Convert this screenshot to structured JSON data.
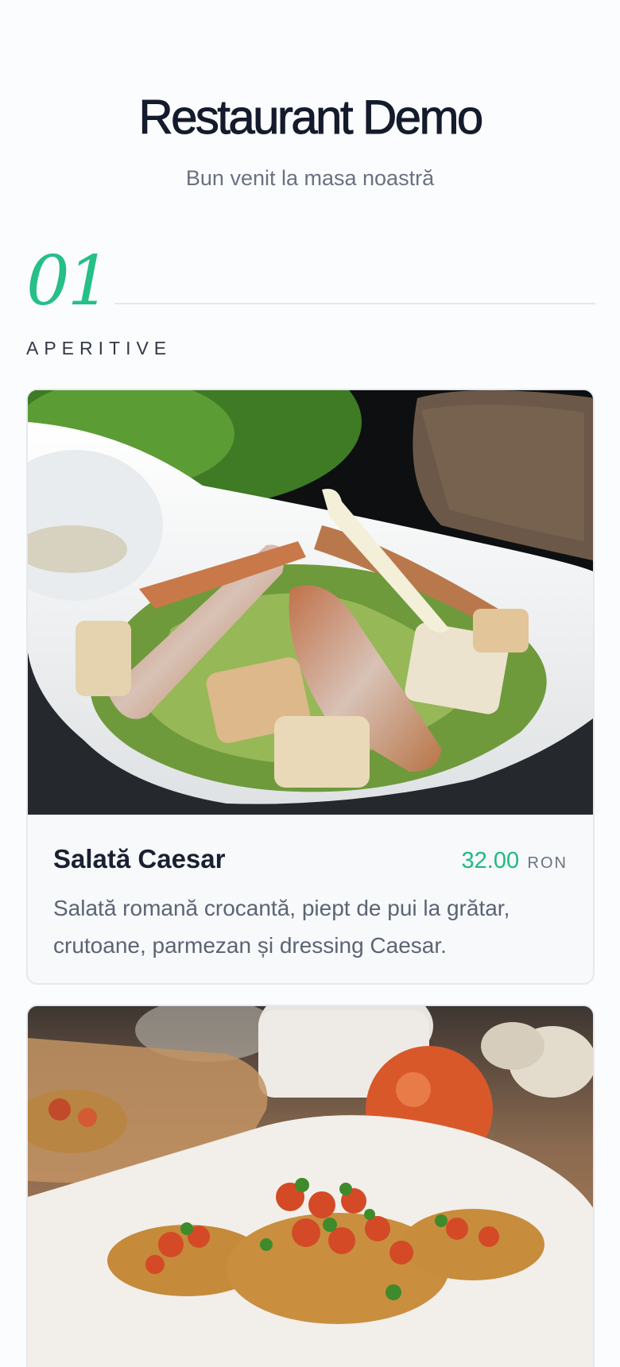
{
  "restaurant": {
    "title": "Restaurant Demo",
    "subtitle": "Bun venit la masa noastră"
  },
  "section": {
    "number": "01",
    "title": "APERITIVE"
  },
  "currency": "RON",
  "colors": {
    "accent": "#25bf87",
    "text_dark": "#141b2c",
    "text_muted": "#697181",
    "card_bg": "#f7f9fb",
    "card_border": "#e5e9ee"
  },
  "items": [
    {
      "name": "Salată Caesar",
      "price": "32.00",
      "description": "Salată romană crocantă, piept de pui la grătar, crutoane, parmezan și dressing Caesar.",
      "image": "caesar-salad-photo"
    },
    {
      "image": "bruschetta-photo"
    }
  ]
}
